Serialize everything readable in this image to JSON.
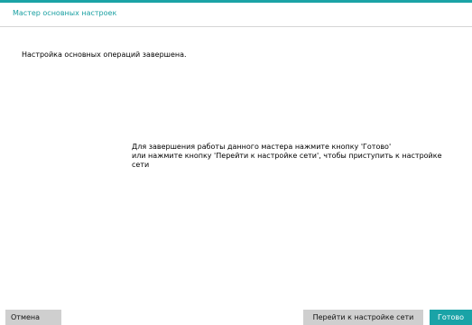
{
  "window": {
    "title": "Мастер основных настроек",
    "accent_color": "#1aa3a7"
  },
  "content": {
    "status_message": "Настройка основных операций завершена.",
    "instruction_lines": [
      "Для завершения работы данного мастера нажмите кнопку 'Готово'",
      "или нажмите кнопку 'Перейти к настройке сети', чтобы приступить к настройке",
      "сети"
    ]
  },
  "buttons": {
    "cancel_label": "Отмена",
    "network_label": "Перейти к настройке сети",
    "done_label": "Готово"
  }
}
